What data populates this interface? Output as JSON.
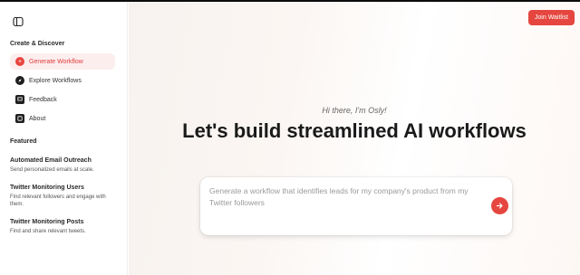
{
  "sidebar": {
    "create_title": "Create & Discover",
    "nav": [
      {
        "label": "Generate Workflow",
        "icon": "plus-icon",
        "active": true
      },
      {
        "label": "Explore Workflows",
        "icon": "compass-icon",
        "active": false
      },
      {
        "label": "Feedback",
        "icon": "message-icon",
        "active": false
      },
      {
        "label": "About",
        "icon": "info-icon",
        "active": false
      }
    ],
    "featured_title": "Featured",
    "featured": [
      {
        "title": "Automated Email Outreach",
        "desc": "Send personalized emails at scale."
      },
      {
        "title": "Twitter Monitoring Users",
        "desc": "Find relevant followers and engage with them."
      },
      {
        "title": "Twitter Monitoring Posts",
        "desc": "Find and share relevant tweets."
      }
    ]
  },
  "header": {
    "join_label": "Join Waitlist"
  },
  "main": {
    "greeting": "Hi there, I'm Osly!",
    "headline": "Let's build streamlined AI workflows",
    "prompt_placeholder": "Generate a workflow that identifies leads for my company's product from my Twitter followers"
  },
  "colors": {
    "accent": "#e5463f",
    "active_bg": "#fdeeee"
  }
}
